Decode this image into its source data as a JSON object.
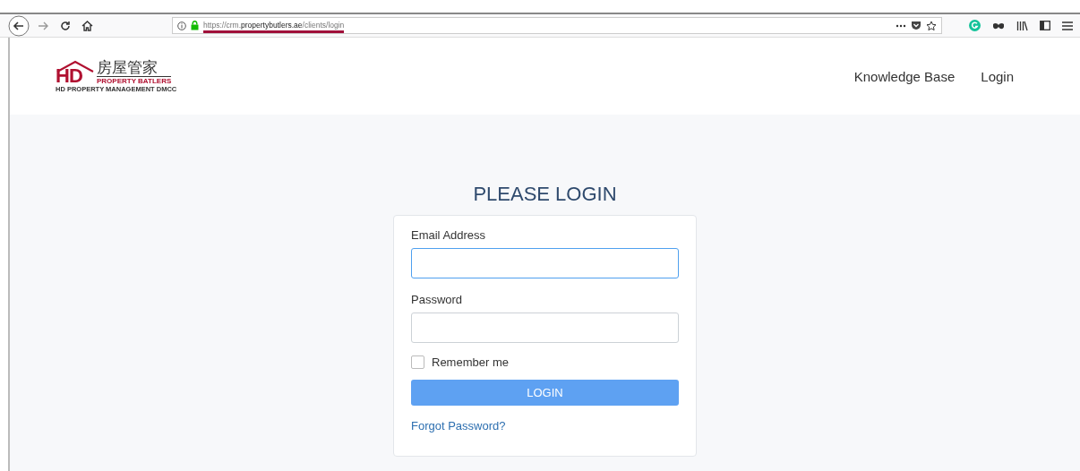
{
  "browser": {
    "url": {
      "prefix": "https://crm.",
      "domain": "propertybutlers.ae",
      "path": "/clients/login"
    }
  },
  "logo": {
    "mark": "HD",
    "chinese": "房屋管家",
    "line_1": "PROPERTY BATLERS",
    "line_2": "HD PROPERTY MANAGEMENT DMCC"
  },
  "nav": [
    {
      "label": "Knowledge Base"
    },
    {
      "label": "Login"
    }
  ],
  "heading": "PLEASE LOGIN",
  "form": {
    "email_label": "Email Address",
    "email_focused": true,
    "password_label": "Password",
    "remember": {
      "label": "Remember me",
      "checked": false
    },
    "submit": "LOGIN",
    "forgot": "Forgot Password?"
  }
}
